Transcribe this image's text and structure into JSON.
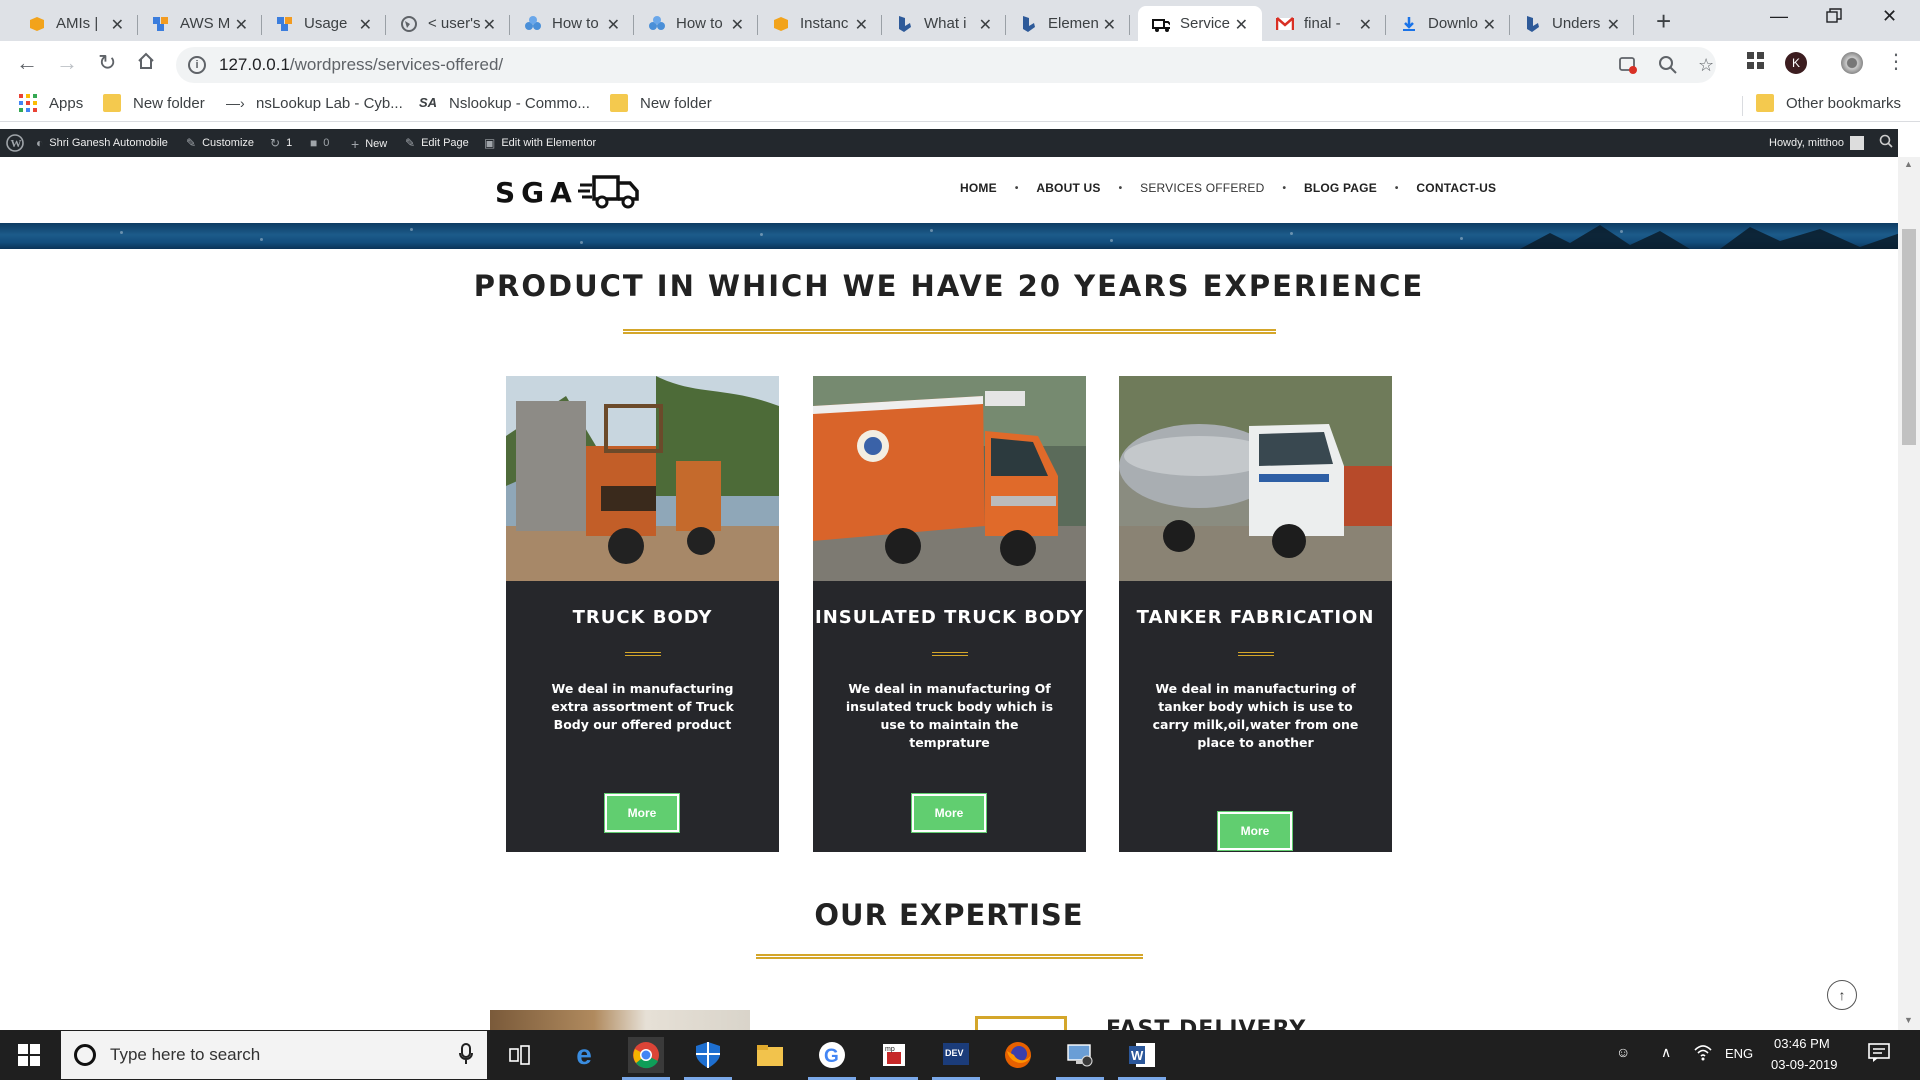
{
  "browser": {
    "tabs": [
      {
        "title": "AMIs |",
        "icon": "aws-box-icon"
      },
      {
        "title": "AWS M",
        "icon": "aws-cubes-icon"
      },
      {
        "title": "Usage",
        "icon": "aws-cubes-icon"
      },
      {
        "title": "< user's",
        "icon": "globe-icon"
      },
      {
        "title": "How to",
        "icon": "cloud-people-icon"
      },
      {
        "title": "How to",
        "icon": "cloud-people-icon"
      },
      {
        "title": "Instanc",
        "icon": "aws-box-icon"
      },
      {
        "title": "What i",
        "icon": "bing-icon"
      },
      {
        "title": "Elemen",
        "icon": "bing-icon"
      },
      {
        "title": "Service",
        "icon": "truck-icon",
        "active": true
      },
      {
        "title": "final -",
        "icon": "gmail-icon"
      },
      {
        "title": "Downlo",
        "icon": "download-icon"
      },
      {
        "title": "Unders",
        "icon": "bing-icon"
      }
    ],
    "url_host": "127.0.0.1",
    "url_path": "/wordpress/services-offered/",
    "profile_initial": "K",
    "bookmarks": [
      {
        "label": "Apps",
        "icon": "apps-grid-icon"
      },
      {
        "label": "New folder",
        "icon": "folder-icon"
      },
      {
        "label": "nsLookup Lab - Cyb...",
        "icon": "nslookup-icon"
      },
      {
        "label": "Nslookup - Commo...",
        "icon": "sa-icon"
      },
      {
        "label": "New folder",
        "icon": "folder-icon"
      }
    ],
    "other_bookmarks": "Other bookmarks"
  },
  "adminbar": {
    "site_name": "Shri Ganesh Automobile",
    "customize": "Customize",
    "updates": "1",
    "comments": "0",
    "new": "New",
    "edit_page": "Edit Page",
    "edit_elementor": "Edit with Elementor",
    "howdy": "Howdy, mitthoo"
  },
  "site": {
    "logo_text": "SGA",
    "nav": [
      "HOME",
      "ABOUT US",
      "SERVICES OFFERED",
      "BLOG PAGE",
      "CONTACT-US"
    ],
    "current_nav": "SERVICES OFFERED",
    "products_heading": "PRODUCT IN WHICH WE HAVE 20 YEARS EXPERIENCE",
    "cards": [
      {
        "title": "TRUCK BODY",
        "text": "We deal in manufacturing extra assortment of Truck Body our offered product",
        "button": "More"
      },
      {
        "title": "INSULATED TRUCK BODY",
        "text": "We deal in manufacturing Of insulated truck body which is use to maintain the temprature",
        "button": "More"
      },
      {
        "title": "TANKER FABRICATION",
        "text": "We deal in manufacturing of tanker body which is use to carry milk,oil,water from one place to another",
        "button": "More"
      }
    ],
    "expertise_heading": "OUR EXPERTISE",
    "expertise_item": "FAST DELIVERY"
  },
  "taskbar": {
    "search_placeholder": "Type here to search",
    "language": "ENG",
    "time": "03:46 PM",
    "date": "03-09-2019"
  },
  "colors": {
    "accent_gold": "#d4a62a",
    "button_green": "#61ce70",
    "card_bg": "#26272b",
    "adminbar_bg": "#23282d"
  }
}
